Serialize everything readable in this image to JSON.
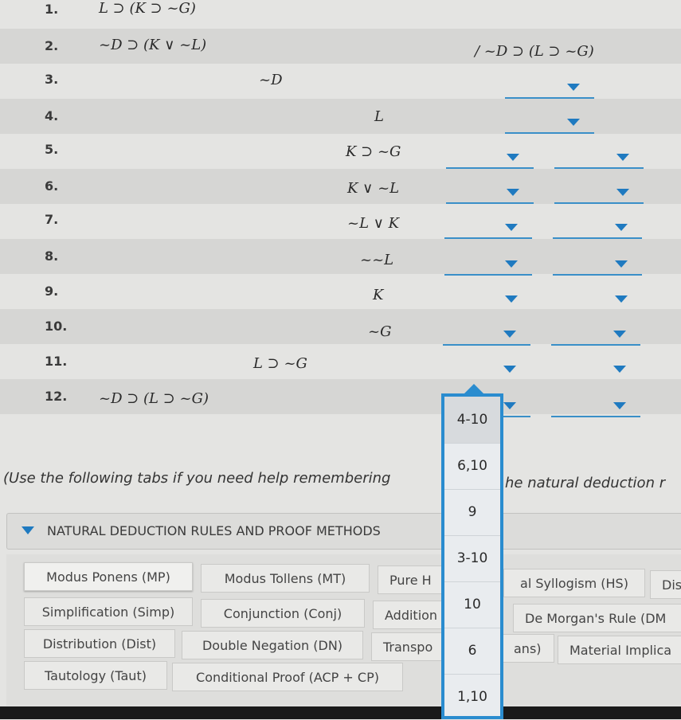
{
  "proof": {
    "conclusion": "/ ~D ⊃ (L ⊃ ~G)",
    "lines": [
      {
        "num": "1.",
        "formula": "L ⊃ (K ⊃ ~G)"
      },
      {
        "num": "2.",
        "formula": "~D ⊃ (K ∨ ~L)"
      },
      {
        "num": "3.",
        "formula": "~D"
      },
      {
        "num": "4.",
        "formula": "L"
      },
      {
        "num": "5.",
        "formula": "K ⊃ ~G"
      },
      {
        "num": "6.",
        "formula": "K ∨ ~L"
      },
      {
        "num": "7.",
        "formula": "~L ∨ K"
      },
      {
        "num": "8.",
        "formula": "~~L"
      },
      {
        "num": "9.",
        "formula": "K"
      },
      {
        "num": "10.",
        "formula": "~G"
      },
      {
        "num": "11.",
        "formula": "L ⊃ ~G"
      },
      {
        "num": "12.",
        "formula": "~D ⊃ (L ⊃ ~G)"
      }
    ]
  },
  "note": {
    "left": "(Use the following tabs if you need help remembering",
    "right": "he natural deduction r"
  },
  "accordion": {
    "label": "NATURAL DEDUCTION RULES AND PROOF METHODS",
    "icon": "triangle-down-icon"
  },
  "tabs": [
    [
      "Modus Ponens (MP)",
      "Modus Tollens (MT)",
      "Pure H",
      "al Syllogism (HS)",
      "Dis"
    ],
    [
      "Simplification (Simp)",
      "Conjunction (Conj)",
      "Addition",
      "De Morgan's Rule (DM"
    ],
    [
      "Distribution (Dist)",
      "Double Negation (DN)",
      "Transpo",
      "ans)",
      "Material Implica"
    ],
    [
      "Tautology (Taut)",
      "Conditional Proof (ACP + CP)"
    ]
  ],
  "dropdown": {
    "options": [
      "4-10",
      "6,10",
      "9",
      "3-10",
      "10",
      "6",
      "1,10"
    ]
  },
  "colors": {
    "accent": "#2a8ccf",
    "arrow": "#1f7ac0"
  }
}
